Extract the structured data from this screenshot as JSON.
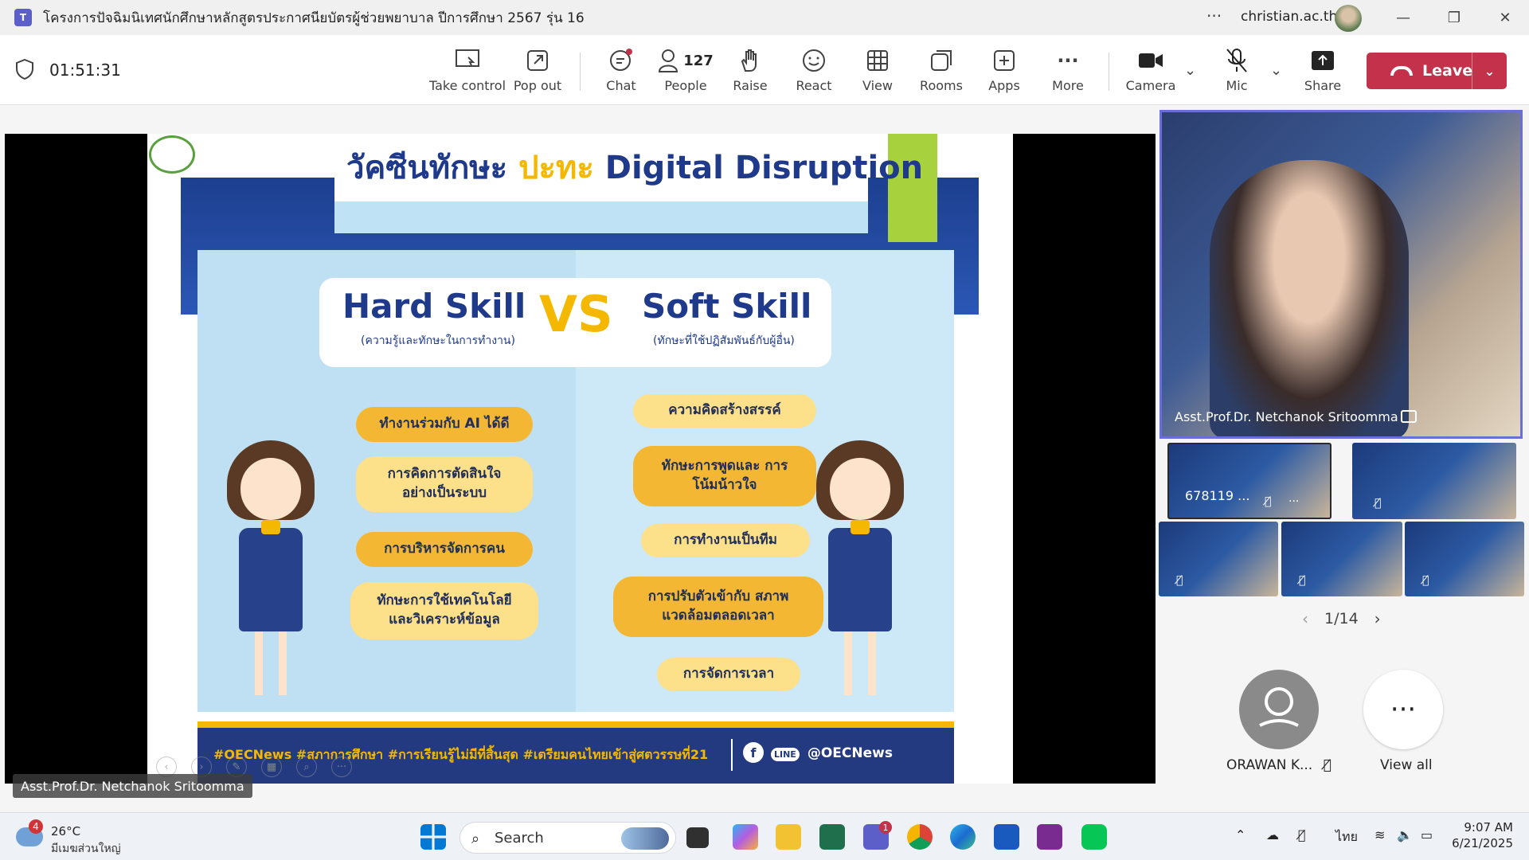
{
  "window": {
    "title": "โครงการปัจฉิมนิเทศนักศึกษาหลักสูตรประกาศนียบัตรผู้ช่วยพยาบาล ปีการศึกษา 2567 รุ่น 16",
    "account": "christian.ac.th",
    "more_icon": "ellipsis-icon"
  },
  "toolbar": {
    "timer": "01:51:31",
    "take_control": "Take control",
    "pop_out": "Pop out",
    "chat": "Chat",
    "people": "People",
    "people_count": "127",
    "raise": "Raise",
    "react": "React",
    "view": "View",
    "rooms": "Rooms",
    "apps": "Apps",
    "more": "More",
    "camera": "Camera",
    "mic": "Mic",
    "share": "Share",
    "leave": "Leave",
    "leave_color": "#c4314b"
  },
  "slide": {
    "title_thai": "วัคซีนทักษะ",
    "title_accent": "ปะทะ",
    "title_rest": "Digital Disruption",
    "hard_skill": "Hard Skill",
    "hard_skill_sub": "(ความรู้และทักษะในการทำงาน)",
    "vs": "VS",
    "soft_skill": "Soft Skill",
    "soft_skill_sub": "(ทักษะที่ใช้ปฏิสัมพันธ์กับผู้อื่น)",
    "hard_items": [
      "ทำงานร่วมกับ AI ได้ดี",
      "การคิดการตัดสินใจ อย่างเป็นระบบ",
      "การบริหารจัดการคน",
      "ทักษะการใช้เทคโนโลยี และวิเคราะห์ข้อมูล"
    ],
    "soft_items": [
      "ความคิดสร้างสรรค์",
      "ทักษะการพูดและ การโน้มน้าวใจ",
      "การทำงานเป็นทีม",
      "การปรับตัวเข้ากับ สภาพแวดล้อมตลอดเวลา",
      "การจัดการเวลา"
    ],
    "hashtags": "#OECNews #สภาการศึกษา #การเรียนรู้ไม่มีที่สิ้นสุด #เตรียมคนไทยเข้าสู่ศตวรรษที่21",
    "handle": "@OECNews",
    "line_label": "LINE",
    "fb_label": "f"
  },
  "stage": {
    "speaker_name": "Asst.Prof.Dr. Netchanok Sritoomma"
  },
  "participants": {
    "main_name": "Asst.Prof.Dr. Netchanok Sritoomma",
    "thumb1_label": "678119 ...",
    "pager": "1/14",
    "roster_name": "ORAWAN K...",
    "view_all": "View all"
  },
  "taskbar": {
    "weather_temp": "26°C",
    "weather_cond": "มีเมฆส่วนใหญ่",
    "weather_badge": "4",
    "search": "Search",
    "teams_badge": "1",
    "lang": "ไทย",
    "time": "9:07 AM",
    "date": "6/21/2025"
  }
}
